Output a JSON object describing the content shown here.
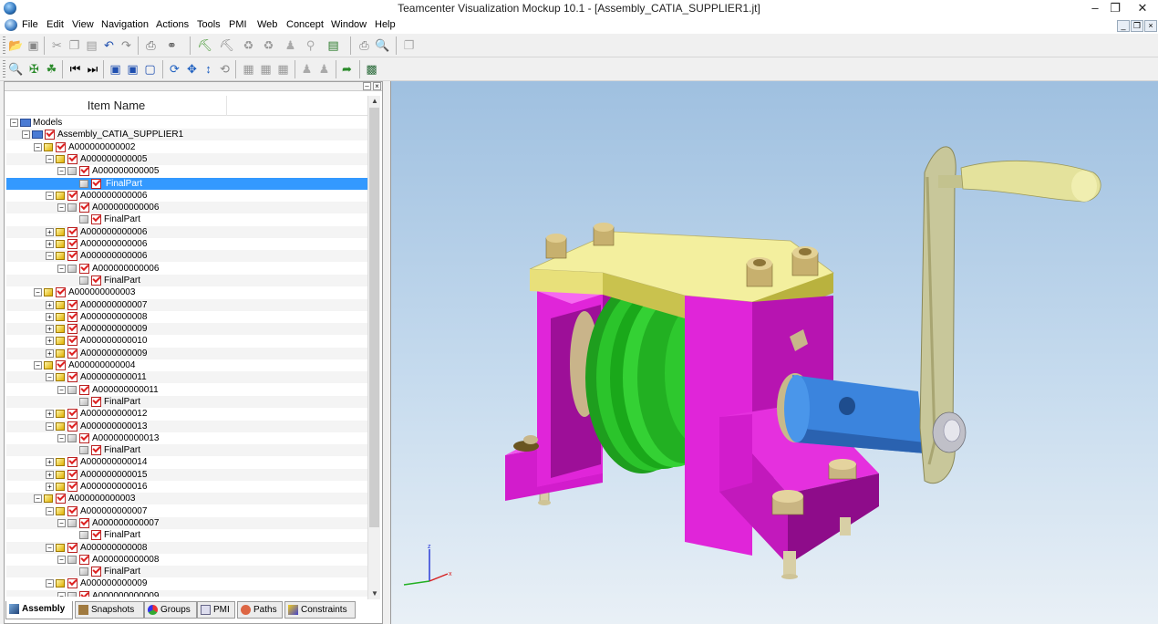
{
  "window": {
    "title": "Teamcenter Visualization Mockup 10.1 - [Assembly_CATIA_SUPPLIER1.jt]"
  },
  "menu": [
    "File",
    "Edit",
    "View",
    "Navigation",
    "Actions",
    "Tools",
    "PMI",
    "Web",
    "Concept",
    "Window",
    "Help"
  ],
  "panel": {
    "column_header": "Item Name"
  },
  "tree": [
    {
      "label": "Models",
      "level": 0,
      "type": "models",
      "exp": "-"
    },
    {
      "label": "Assembly_CATIA_SUPPLIER1",
      "level": 1,
      "type": "asm",
      "exp": "-"
    },
    {
      "label": "A000000000002",
      "level": 2,
      "type": "y",
      "exp": "-"
    },
    {
      "label": "A000000000005",
      "level": 3,
      "type": "y",
      "exp": "-"
    },
    {
      "label": "A000000000005",
      "level": 4,
      "type": "g",
      "exp": "-"
    },
    {
      "label": "FinalPart",
      "level": 5,
      "type": "g",
      "exp": "",
      "selected": true
    },
    {
      "label": "A000000000006",
      "level": 3,
      "type": "y",
      "exp": "-"
    },
    {
      "label": "A000000000006",
      "level": 4,
      "type": "g",
      "exp": "-"
    },
    {
      "label": "FinalPart",
      "level": 5,
      "type": "g",
      "exp": ""
    },
    {
      "label": "A000000000006",
      "level": 3,
      "type": "y",
      "exp": "+"
    },
    {
      "label": "A000000000006",
      "level": 3,
      "type": "y",
      "exp": "+"
    },
    {
      "label": "A000000000006",
      "level": 3,
      "type": "y",
      "exp": "-"
    },
    {
      "label": "A000000000006",
      "level": 4,
      "type": "g",
      "exp": "-"
    },
    {
      "label": "FinalPart",
      "level": 5,
      "type": "g",
      "exp": ""
    },
    {
      "label": "A000000000003",
      "level": 2,
      "type": "y",
      "exp": "-"
    },
    {
      "label": "A000000000007",
      "level": 3,
      "type": "y",
      "exp": "+"
    },
    {
      "label": "A000000000008",
      "level": 3,
      "type": "y",
      "exp": "+"
    },
    {
      "label": "A000000000009",
      "level": 3,
      "type": "y",
      "exp": "+"
    },
    {
      "label": "A000000000010",
      "level": 3,
      "type": "y",
      "exp": "+"
    },
    {
      "label": "A000000000009",
      "level": 3,
      "type": "y",
      "exp": "+"
    },
    {
      "label": "A000000000004",
      "level": 2,
      "type": "y",
      "exp": "-"
    },
    {
      "label": "A000000000011",
      "level": 3,
      "type": "y",
      "exp": "-"
    },
    {
      "label": "A000000000011",
      "level": 4,
      "type": "g",
      "exp": "-"
    },
    {
      "label": "FinalPart",
      "level": 5,
      "type": "g",
      "exp": ""
    },
    {
      "label": "A000000000012",
      "level": 3,
      "type": "y",
      "exp": "+"
    },
    {
      "label": "A000000000013",
      "level": 3,
      "type": "y",
      "exp": "-"
    },
    {
      "label": "A000000000013",
      "level": 4,
      "type": "g",
      "exp": "-"
    },
    {
      "label": "FinalPart",
      "level": 5,
      "type": "g",
      "exp": ""
    },
    {
      "label": "A000000000014",
      "level": 3,
      "type": "y",
      "exp": "+"
    },
    {
      "label": "A000000000015",
      "level": 3,
      "type": "y",
      "exp": "+"
    },
    {
      "label": "A000000000016",
      "level": 3,
      "type": "y",
      "exp": "+"
    },
    {
      "label": "A000000000003",
      "level": 2,
      "type": "y",
      "exp": "-"
    },
    {
      "label": "A000000000007",
      "level": 3,
      "type": "y",
      "exp": "-"
    },
    {
      "label": "A000000000007",
      "level": 4,
      "type": "g",
      "exp": "-"
    },
    {
      "label": "FinalPart",
      "level": 5,
      "type": "g",
      "exp": ""
    },
    {
      "label": "A000000000008",
      "level": 3,
      "type": "y",
      "exp": "-"
    },
    {
      "label": "A000000000008",
      "level": 4,
      "type": "g",
      "exp": "-"
    },
    {
      "label": "FinalPart",
      "level": 5,
      "type": "g",
      "exp": ""
    },
    {
      "label": "A000000000009",
      "level": 3,
      "type": "y",
      "exp": "-"
    },
    {
      "label": "A000000000009",
      "level": 4,
      "type": "g",
      "exp": "-"
    }
  ],
  "tabs": [
    {
      "label": "Assembly",
      "icon": "assembly-icon",
      "active": true
    },
    {
      "label": "Snapshots",
      "icon": "snapshots-icon"
    },
    {
      "label": "Groups",
      "icon": "groups-icon"
    },
    {
      "label": "PMI",
      "icon": "pmi-icon"
    },
    {
      "label": "Paths",
      "icon": "paths-icon"
    },
    {
      "label": "Constraints",
      "icon": "constraints-icon"
    }
  ],
  "axes": {
    "x": "x",
    "z": "z"
  },
  "colors": {
    "selection": "#3399ff",
    "bracket": "#e020d8",
    "plate": "#f2ee9a",
    "wheel": "#22c422",
    "shaft": "#3a7fd6",
    "handle": "#c8c79a"
  }
}
